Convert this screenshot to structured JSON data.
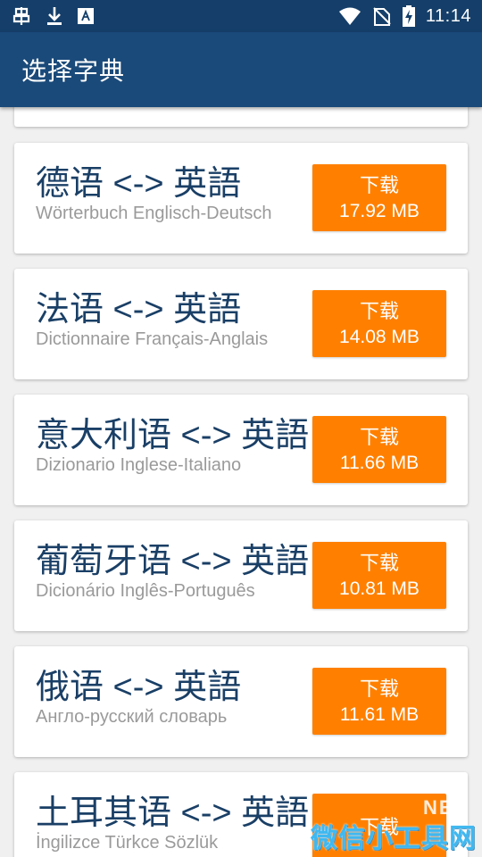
{
  "status_bar": {
    "time": "11:14",
    "icons": [
      "app-notification-icon",
      "download-icon",
      "font-icon",
      "wifi-icon",
      "no-sim-icon",
      "battery-charging-icon"
    ]
  },
  "app_bar": {
    "title": "选择字典"
  },
  "dictionaries": [
    {
      "title": "德语 <-> 英語",
      "subtitle": "Wörterbuch Englisch-Deutsch",
      "button_label": "下载",
      "size": "17.92 MB"
    },
    {
      "title": "法语 <-> 英語",
      "subtitle": "Dictionnaire Français-Anglais",
      "button_label": "下载",
      "size": "14.08 MB"
    },
    {
      "title": "意大利语 <-> 英語",
      "subtitle": "Dizionario Inglese-Italiano",
      "button_label": "下载",
      "size": "11.66 MB"
    },
    {
      "title": "葡萄牙语 <-> 英語",
      "subtitle": "Dicionário Inglês-Português",
      "button_label": "下载",
      "size": "10.81 MB"
    },
    {
      "title": "俄语 <-> 英語",
      "subtitle": "Англо-русский словарь",
      "button_label": "下载",
      "size": "11.61 MB"
    },
    {
      "title": "土耳其语 <-> 英語",
      "subtitle": "İngilizce Türkce Sözlük",
      "button_label": "下载",
      "size": ""
    }
  ],
  "watermark": {
    "text": "微信小工具网",
    "net": "NET"
  },
  "colors": {
    "status_bar": "#153f6a",
    "app_bar": "#1a4a7a",
    "button": "#ff8000",
    "title_text": "#1a3f66"
  }
}
